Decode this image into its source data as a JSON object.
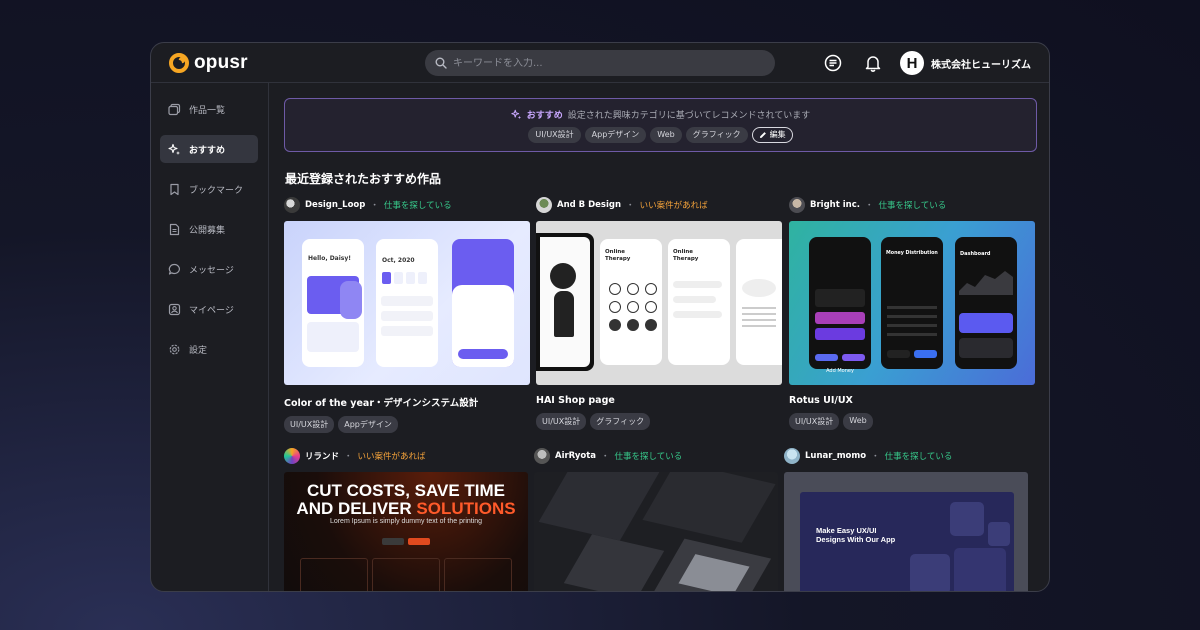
{
  "header": {
    "logo_text": "opusr",
    "search_placeholder": "キーワードを入力...",
    "company_initial": "H",
    "company_name": "株式会社ヒューリズム"
  },
  "sidebar": {
    "items": [
      {
        "label": "作品一覧",
        "icon": "gallery-icon",
        "active": false
      },
      {
        "label": "おすすめ",
        "icon": "sparkle-icon",
        "active": true
      },
      {
        "label": "ブックマーク",
        "icon": "bookmark-icon",
        "active": false
      },
      {
        "label": "公開募集",
        "icon": "document-icon",
        "active": false
      },
      {
        "label": "メッセージ",
        "icon": "message-icon",
        "active": false
      },
      {
        "label": "マイページ",
        "icon": "profile-icon",
        "active": false
      },
      {
        "label": "設定",
        "icon": "gear-icon",
        "active": false
      }
    ]
  },
  "recommend": {
    "title": "おすすめ",
    "description": "設定された興味カテゴリに基づいてレコメンドされています",
    "tags": [
      "UI/UX設計",
      "Appデザイン",
      "Web",
      "グラフィック"
    ],
    "edit_label": "編集"
  },
  "section_title": "最近登録されたおすすめ作品",
  "cards": [
    {
      "user": "Design_Loop",
      "status": "仕事を探している",
      "status_color": "#37c98b",
      "title": "Color of the year・デザインシステム設計",
      "tags": [
        "UI/UX設計",
        "Appデザイン"
      ]
    },
    {
      "user": "And B Design",
      "status": "いい案件があれば",
      "status_color": "#f3a23a",
      "title": "HAI Shop page",
      "tags": [
        "UI/UX設計",
        "グラフィック"
      ]
    },
    {
      "user": "Bright inc.",
      "status": "仕事を探している",
      "status_color": "#37c98b",
      "title": "Rotus UI/UX",
      "tags": [
        "UI/UX設計",
        "Web"
      ]
    },
    {
      "user": "リランド",
      "status": "いい案件があれば",
      "status_color": "#f3a23a",
      "title": "",
      "tags": []
    },
    {
      "user": "AirRyota",
      "status": "仕事を探している",
      "status_color": "#37c98b",
      "title": "",
      "tags": []
    },
    {
      "user": "Lunar_momo",
      "status": "仕事を探している",
      "status_color": "#37c98b",
      "title": "",
      "tags": []
    }
  ],
  "thumb_texts": {
    "t1_greeting": "Hello, Daisy!",
    "t1_date": "Oct, 2020",
    "t2_word": "Online Therapy",
    "t3_title": "Money Distribution",
    "t3_dashboard": "Dashboard",
    "t3_add": "Add Money",
    "t4_line1": "CUT COSTS, SAVE TIME",
    "t4_line2a": "AND DELIVER ",
    "t4_line2b": "SOLUTIONS",
    "t4_sub": "Lorem Ipsum is simply dummy text of the printing",
    "t6_headline": "Make Easy UX/UI Designs With Our App"
  },
  "colors": {
    "accent_purple": "#6e5aa6",
    "status_green": "#37c98b",
    "status_orange": "#f3a23a",
    "logo_orange": "#f6a623"
  }
}
